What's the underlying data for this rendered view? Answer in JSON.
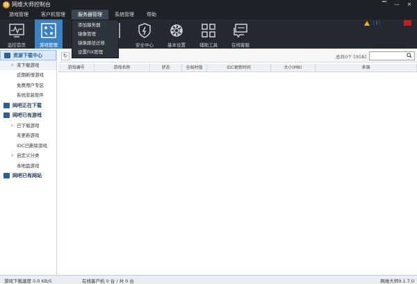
{
  "window": {
    "logo_text": "D",
    "title": "网维大师控制台",
    "controls": [
      "▔",
      "—",
      "✕"
    ]
  },
  "menu": [
    {
      "label": "游戏管理"
    },
    {
      "label": "客户机管理"
    },
    {
      "label": "服务器管理"
    },
    {
      "label": "系统管理"
    },
    {
      "label": "帮助"
    }
  ],
  "menu_active_index": 2,
  "dropdown": [
    "添加服务器",
    "镜像管理",
    "镜像路径迁移",
    "设置FIX管理"
  ],
  "toolbar": [
    {
      "label": "监控首页",
      "icon": "monitor-icon"
    },
    {
      "label": "游戏管理",
      "icon": "gamepad-icon"
    },
    {
      "label": "",
      "icon": "client-icon"
    },
    {
      "label": "理",
      "icon": "server-icon"
    },
    {
      "label": "安全中心",
      "icon": "shield-icon"
    },
    {
      "label": "基本设置",
      "icon": "gear-icon"
    },
    {
      "label": "辅助工具",
      "icon": "grid-icon"
    },
    {
      "label": "在线客服",
      "icon": "chat-icon"
    }
  ],
  "toolbar_active_index": 1,
  "status_indicator": {
    "bars": "| ‖ |"
  },
  "sidebar": [
    {
      "label": "资源下载中心",
      "type": "section",
      "active": true
    },
    {
      "label": "未下载游戏",
      "type": "sub",
      "tri": true
    },
    {
      "label": "近期新增游戏",
      "type": "sub"
    },
    {
      "label": "免费用户专区",
      "type": "sub"
    },
    {
      "label": "系统安装软件",
      "type": "sub"
    },
    {
      "label": "网吧正在下载",
      "type": "section"
    },
    {
      "label": "网吧已有游戏",
      "type": "section"
    },
    {
      "label": "已下载游戏",
      "type": "sub",
      "tri": true
    },
    {
      "label": "未更新游戏",
      "type": "sub"
    },
    {
      "label": "IDC已删除游戏",
      "type": "sub"
    },
    {
      "label": "自定义分类",
      "type": "sub",
      "tri": true
    },
    {
      "label": "本地盘游戏",
      "type": "sub"
    },
    {
      "label": "网吧已有网站",
      "type": "section"
    }
  ],
  "content": {
    "count_text": "总共0个 [0GB]",
    "search_placeholder": "",
    "columns": [
      "游戏编号",
      "游戏名称",
      "状态",
      "全局时值",
      "IDC更新时间",
      "大小(MB)",
      "来源"
    ]
  },
  "statusbar": {
    "download_speed": "游戏下载速度 0.0 KB/S",
    "online_clients": "在线客户机 0 台 / 共 0 台",
    "version": "网维大师9.1.7.0"
  },
  "colors": {
    "titlebar": "#1e2226",
    "toolbar": "#252a30",
    "accent": "#3b82c4",
    "warning": "#f2b81a",
    "alert": "#c81d1d"
  }
}
